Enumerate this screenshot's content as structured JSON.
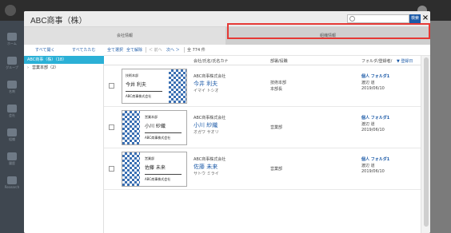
{
  "modal": {
    "title": "ABC商事（株）",
    "search_button": "検索",
    "close": "×"
  },
  "tabs": [
    {
      "label": "会社情報"
    },
    {
      "label": "組織情報"
    }
  ],
  "toolbar": {
    "expand_all": "すべて開く",
    "collapse_all": "すべてたたむ",
    "select_all": "全て選択",
    "deselect_all": "全て解除",
    "prev": "＜ 前へ",
    "next": "次へ ＞",
    "count": "全 774 件"
  },
  "tree": {
    "selected": "ABC商事（株）（18）",
    "child": "営業本部（2）"
  },
  "list_header": {
    "company_name": "会社/氏名/氏名カナ",
    "department": "部署/役職",
    "folder": "フォルダ/登録者/",
    "sort": "▼ 登録日"
  },
  "rows": [
    {
      "card_company": "技術本部",
      "card_name": "今井 利夫",
      "card_footer": "ABC商事株式会社",
      "company": "ABC商事株式会社",
      "name": "今井 利夫",
      "kana": "イマイ トシオ",
      "dept": "技術本部",
      "title": "本部長",
      "folder": "個人 フォルダ1",
      "registrant": "渡辺 道",
      "date": "2019/06/10"
    },
    {
      "card_company": "営業本部",
      "card_name": "小川 紗織",
      "card_footer": "ABC商事株式会社",
      "company": "ABC商事株式会社",
      "name": "小川 紗織",
      "kana": "オガワ サオリ",
      "dept": "営業部",
      "title": "",
      "folder": "個人 フォルダ1",
      "registrant": "渡辺 道",
      "date": "2019/06/10"
    },
    {
      "card_company": "営業部",
      "card_name": "佐藤 未来",
      "card_footer": "ABC商事株式会社",
      "company": "ABC商事株式会社",
      "name": "佐藤 未来",
      "kana": "サトウ ミライ",
      "dept": "営業部",
      "title": "",
      "folder": "個人 フォルダ1",
      "registrant": "渡辺 道",
      "date": "2019/06/10"
    }
  ],
  "background_sidebar": [
    {
      "label": "ホーム",
      "icon": "home-icon"
    },
    {
      "label": "グループ",
      "icon": "group-icon"
    },
    {
      "label": "名刺",
      "icon": "card-icon"
    },
    {
      "label": "会社",
      "icon": "company-icon"
    },
    {
      "label": "組織",
      "icon": "org-icon"
    },
    {
      "label": "履歴",
      "icon": "history-icon"
    },
    {
      "label": "Research",
      "icon": "research-icon"
    }
  ],
  "colors": {
    "accent": "#1d5ba8",
    "tree_selected": "#2bb0d6",
    "highlight": "#e53935"
  }
}
